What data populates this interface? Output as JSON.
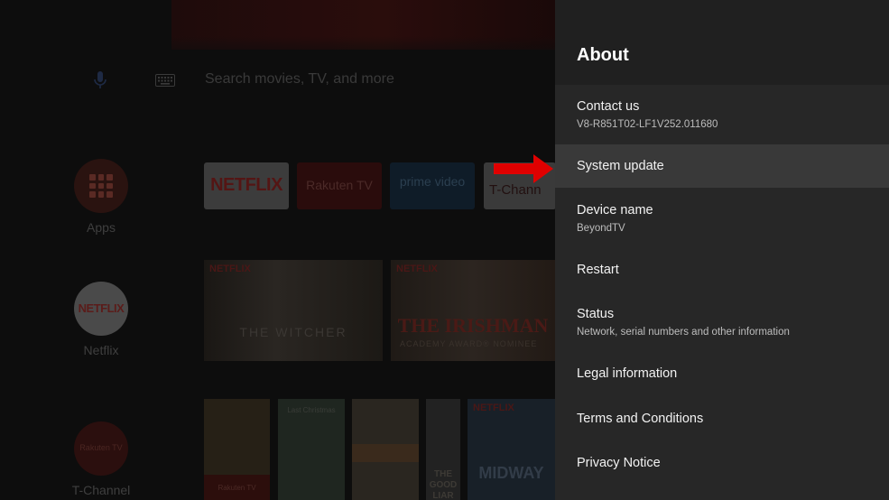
{
  "launcher": {
    "search_placeholder": "Search movies, TV, and more",
    "sidebar": [
      {
        "label": "Apps"
      },
      {
        "label": "Netflix",
        "logo_text": "NETFLIX"
      },
      {
        "label": "T-Channel",
        "logo_text": "Rakuten TV"
      }
    ],
    "app_row": [
      {
        "text": "NETFLIX"
      },
      {
        "text": "Rakuten TV"
      },
      {
        "text": "prime video"
      },
      {
        "text": "T-Chann"
      }
    ],
    "featured_row": [
      {
        "badge": "NETFLIX",
        "title": "THE WITCHER"
      },
      {
        "badge": "NETFLIX",
        "title": "THE IRISHMAN",
        "subtitle": "ACADEMY AWARD® NOMINEE"
      }
    ],
    "bottom_row": [
      {
        "badge": "Rakuten TV"
      },
      {
        "title": "Last Christmas"
      },
      {
        "title": ""
      },
      {
        "title": "THE GOOD LIAR"
      },
      {
        "badge": "NETFLIX",
        "title": "MIDWAY"
      }
    ]
  },
  "panel": {
    "title": "About",
    "items": [
      {
        "label": "Contact us",
        "sub": "V8-R851T02-LF1V252.011680"
      },
      {
        "label": "System update",
        "sub": ""
      },
      {
        "label": "Device name",
        "sub": "BeyondTV"
      },
      {
        "label": "Restart",
        "sub": ""
      },
      {
        "label": "Status",
        "sub": "Network, serial numbers and other information"
      },
      {
        "label": "Legal information",
        "sub": ""
      },
      {
        "label": "Terms and Conditions",
        "sub": ""
      },
      {
        "label": "Privacy Notice",
        "sub": ""
      }
    ],
    "selected_index": 1
  },
  "colors": {
    "panel_bg": "#272727",
    "panel_header_bg": "#202020",
    "selected_bg": "#393939",
    "arrow": "#ff0000",
    "netflix_red": "#e50914"
  }
}
